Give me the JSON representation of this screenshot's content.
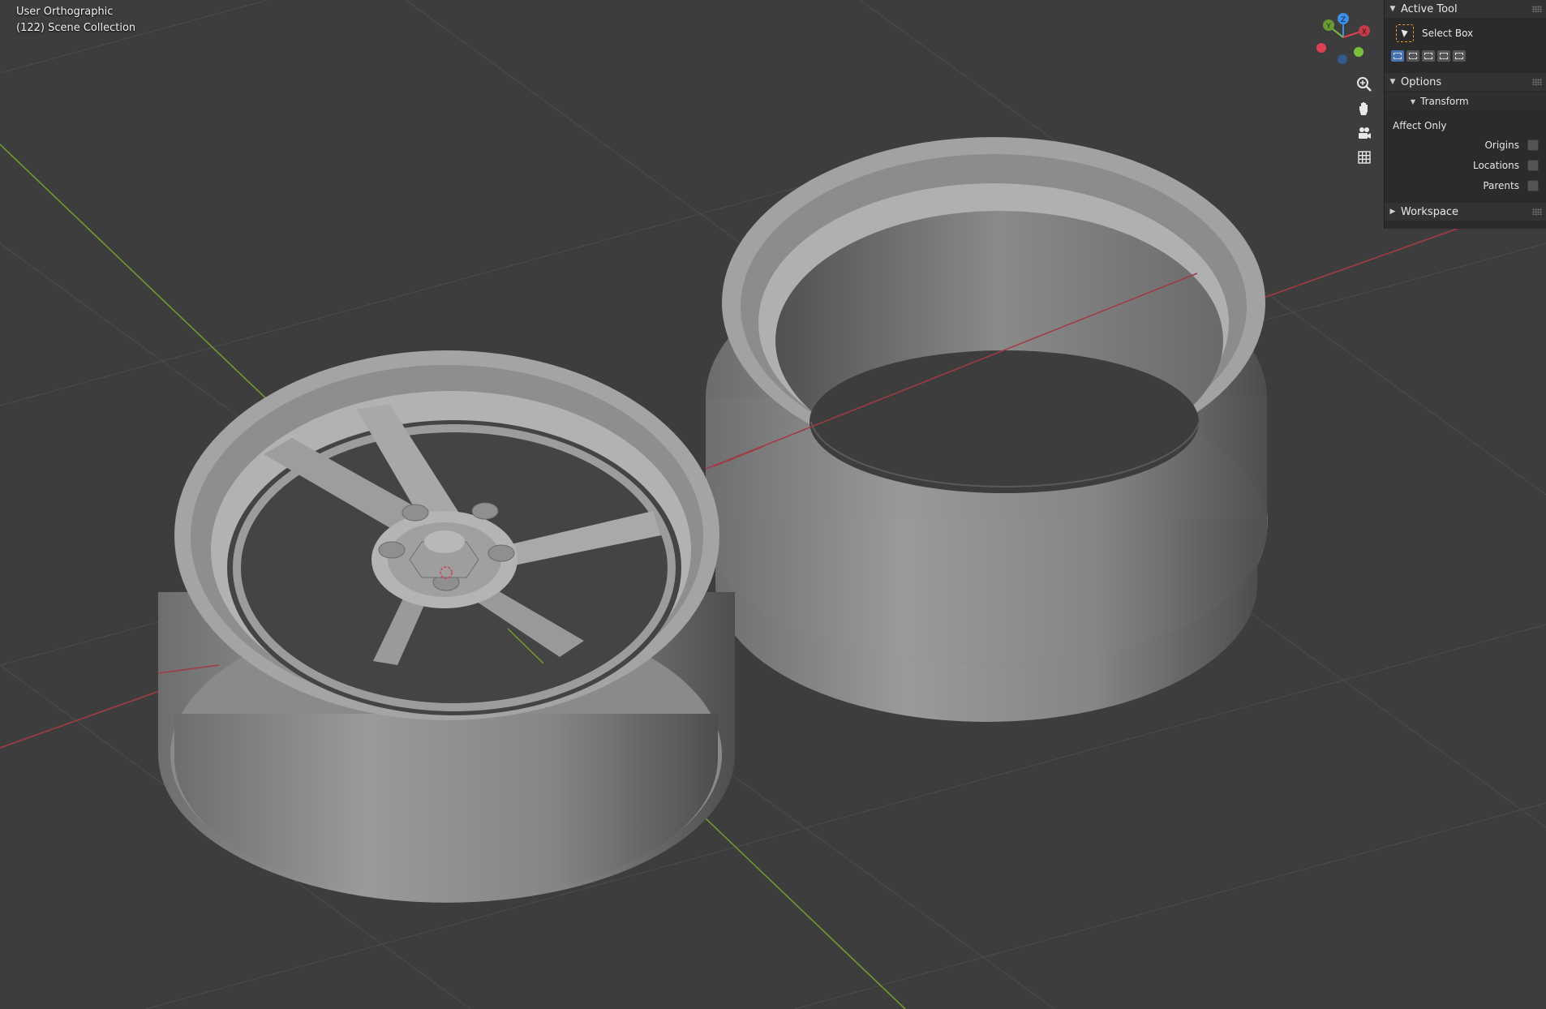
{
  "viewport": {
    "view_name": "User Orthographic",
    "collection_label": "(122) Scene Collection"
  },
  "gizmo": {
    "z_label": "Z",
    "y_label": "Y",
    "x_label": "X",
    "colors": {
      "x": "#e04152",
      "y": "#7bbf3d",
      "z": "#3c8ee6"
    }
  },
  "nav_buttons": [
    {
      "icon": "zoom-icon"
    },
    {
      "icon": "hand-pan-icon"
    },
    {
      "icon": "camera-icon"
    },
    {
      "icon": "grid-icon"
    }
  ],
  "sidebar": {
    "active_tool": {
      "title": "Active Tool",
      "tool_name": "Select Box"
    },
    "options": {
      "title": "Options",
      "transform_title": "Transform",
      "affect_only_label": "Affect Only",
      "checkboxes": [
        {
          "label": "Origins",
          "checked": false
        },
        {
          "label": "Locations",
          "checked": false
        },
        {
          "label": "Parents",
          "checked": false
        }
      ]
    },
    "workspace": {
      "title": "Workspace"
    }
  },
  "colors": {
    "background": "#3d3d3d",
    "x_axis": "#a23a44",
    "y_axis": "#6f9a2e",
    "accent": "#4772b3"
  }
}
